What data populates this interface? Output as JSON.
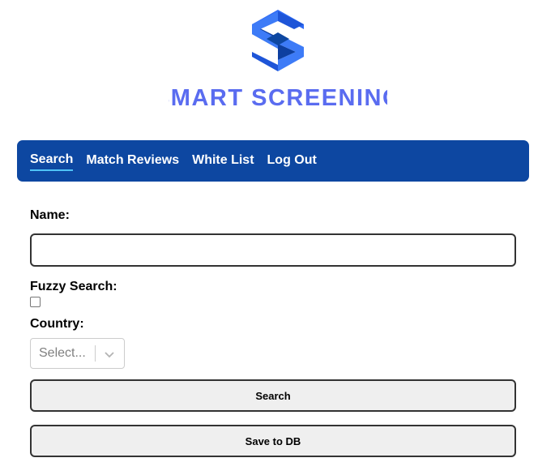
{
  "brand": {
    "name": "SMART SCREENING",
    "logo_icon": "s-logo-icon",
    "colors": {
      "logo_dark": "#0d47a1",
      "logo_light": "#3d7bf7",
      "logo_text": "#5a6cf0",
      "nav_bg": "#0d47a1",
      "active_underline": "#4fc3f7"
    }
  },
  "nav": {
    "items": [
      {
        "label": "Search",
        "active": true
      },
      {
        "label": "Match Reviews",
        "active": false
      },
      {
        "label": "White List",
        "active": false
      },
      {
        "label": "Log Out",
        "active": false
      }
    ]
  },
  "form": {
    "name_label": "Name:",
    "name_value": "",
    "fuzzy_label": "Fuzzy Search:",
    "fuzzy_checked": false,
    "country_label": "Country:",
    "country_placeholder": "Select...",
    "country_icon": "chevron-down-icon",
    "search_button": "Search",
    "save_button": "Save to DB"
  }
}
